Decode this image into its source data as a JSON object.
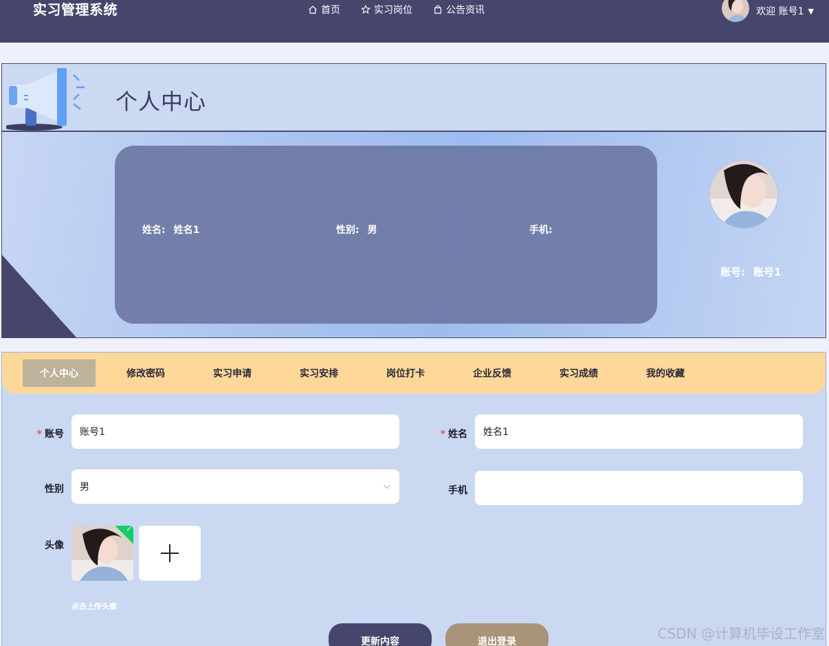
{
  "brand": "实习管理系统",
  "nav": [
    {
      "label": "首页",
      "icon": "home-icon"
    },
    {
      "label": "实习岗位",
      "icon": "star-icon"
    },
    {
      "label": "公告资讯",
      "icon": "bag-icon"
    }
  ],
  "user": {
    "greeting": "欢迎 账号1"
  },
  "page_title": "个人中心",
  "profile": {
    "name_label": "姓名:",
    "name_value": "姓名1",
    "gender_label": "性别:",
    "gender_value": "男",
    "phone_label": "手机:",
    "phone_value": "",
    "account_label": "账号:",
    "account_value": "账号1"
  },
  "tabs": [
    "个人中心",
    "修改密码",
    "实习申请",
    "实习安排",
    "岗位打卡",
    "企业反馈",
    "实习成绩",
    "我的收藏"
  ],
  "form": {
    "account_label": "账号",
    "account_value": "账号1",
    "name_label": "姓名",
    "name_value": "姓名1",
    "gender_label": "性别",
    "gender_value": "男",
    "phone_label": "手机",
    "phone_value": "",
    "avatar_label": "头像",
    "upload_tip": "点击上传头像",
    "update_button": "更新内容",
    "logout_button": "退出登录"
  },
  "watermark": "CSDN @计算机毕设工作室",
  "colors": {
    "nav_bg": "#46466d",
    "tab_bar": "#fdd899",
    "tab_active": "#bdb29c",
    "panel_bg": "#cad8f1",
    "update_btn": "#46466d",
    "logout_btn": "#a89478"
  }
}
